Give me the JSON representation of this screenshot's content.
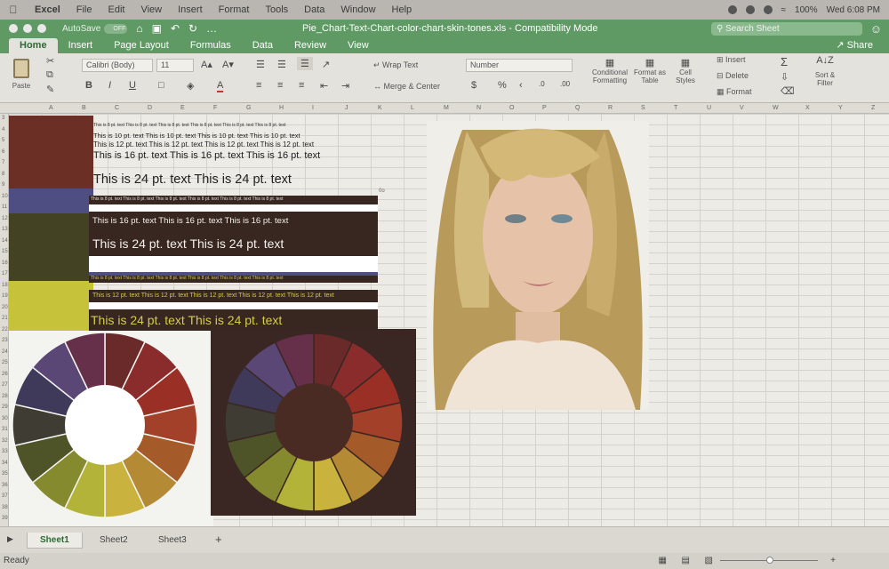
{
  "menubar": {
    "apple": "",
    "items": [
      "Excel",
      "File",
      "Edit",
      "View",
      "Insert",
      "Format",
      "Tools",
      "Data",
      "Window",
      "Help"
    ],
    "battery": "100%",
    "clock": "Wed 6:08 PM"
  },
  "titlebar": {
    "autosave_label": "AutoSave",
    "autosave_state": "OFF",
    "filename": "Pie_Chart-Text-Chart-color-chart-skin-tones.xls - Compatibility Mode",
    "search_placeholder": "Search Sheet"
  },
  "tabs": [
    "Home",
    "Insert",
    "Page Layout",
    "Formulas",
    "Data",
    "Review",
    "View"
  ],
  "share_label": "Share",
  "ribbon": {
    "paste_label": "Paste",
    "font_name": "Calibri (Body)",
    "font_size": "11",
    "grow_font": "A▴",
    "shrink_font": "A▾",
    "bold": "B",
    "italic": "I",
    "underline": "U",
    "wrap_text": "Wrap Text",
    "merge_center": "Merge & Center",
    "number_format": "Number",
    "currency": "$",
    "percent": "%",
    "comma": "‹",
    "conditional_formatting": "Conditional Formatting",
    "format_as_table": "Format as Table",
    "cell_styles": "Cell Styles",
    "insert": "Insert",
    "delete": "Delete",
    "format": "Format",
    "sort_filter": "Sort & Filter",
    "sum": "Σ"
  },
  "columns": [
    "A",
    "B",
    "C",
    "D",
    "E",
    "F",
    "G",
    "H",
    "I",
    "J",
    "K",
    "L",
    "M",
    "N",
    "O",
    "P",
    "Q",
    "R",
    "S",
    "T",
    "U",
    "V",
    "W",
    "X",
    "Y",
    "Z"
  ],
  "rows": [
    "3",
    "4",
    "5",
    "6",
    "7",
    "8",
    "9",
    "10",
    "11",
    "12",
    "13",
    "14",
    "15",
    "16",
    "17",
    "18",
    "19",
    "20",
    "21",
    "22",
    "23",
    "24",
    "25",
    "26",
    "27",
    "28",
    "29",
    "30",
    "31",
    "32",
    "33",
    "34",
    "35",
    "36",
    "37",
    "38",
    "39"
  ],
  "colors": {
    "swatch_brown": "#6b2f25",
    "swatch_blue": "#4e4e82",
    "swatch_olive": "#434324",
    "swatch_yellow": "#c6c23a",
    "band_dark": "#382621",
    "band_light": "#ffffff",
    "text_yellow": "#d4cc4a"
  },
  "cells": {
    "t8": "This is 8 pt. text   This is 8 pt. text   This is 8 pt. text   This is 8 pt. text   This is 8 pt. text   This is 8 pt. text",
    "t10": "This is 10 pt. text   This is 10 pt. text   This is 10 pt. text   This is 10 pt. text",
    "t12": "This is 12 pt. text   This is 12 pt. text   This is 12 pt. text   This is 12 pt. text",
    "t16": "This is 16 pt. text   This is 16 pt. text   This is 16 pt. text",
    "t24": "This is 24 pt. text   This is 24 pt. text",
    "band8": "This is 8 pt. text   This is 8 pt. text   This is 8 pt. text   This is 8 pt. text   This is 8 pt. text   This is 8 pt. text",
    "band16": "This is 16 pt. text   This is 16 pt. text   This is 16 pt. text",
    "band24": "This is 24 pt. text   This is 24 pt. text",
    "y8": "This is 8 pt. text   This is 8 pt. text   This is 8 pt. text   This is 8 pt. text   This is 8 pt. text   This is 8 pt. text",
    "y12": "This is 12 pt. text   This is 12 pt. text   This is 12 pt. text   This is 12 pt. text   This is 12 pt. text",
    "y24": "This is 24 pt. text   This is 24 pt. text",
    "odd": "0o"
  },
  "wheel_colors": [
    "#6b2a2a",
    "#8a2c2c",
    "#9a2f25",
    "#a2402a",
    "#a55a2a",
    "#b48a35",
    "#c9b33e",
    "#b3b33a",
    "#858a2e",
    "#4e5328",
    "#3f3c33",
    "#3f3a5a",
    "#5b4775",
    "#66304a"
  ],
  "sheets": [
    "Sheet1",
    "Sheet2",
    "Sheet3"
  ],
  "add_sheet": "+",
  "status": "Ready"
}
